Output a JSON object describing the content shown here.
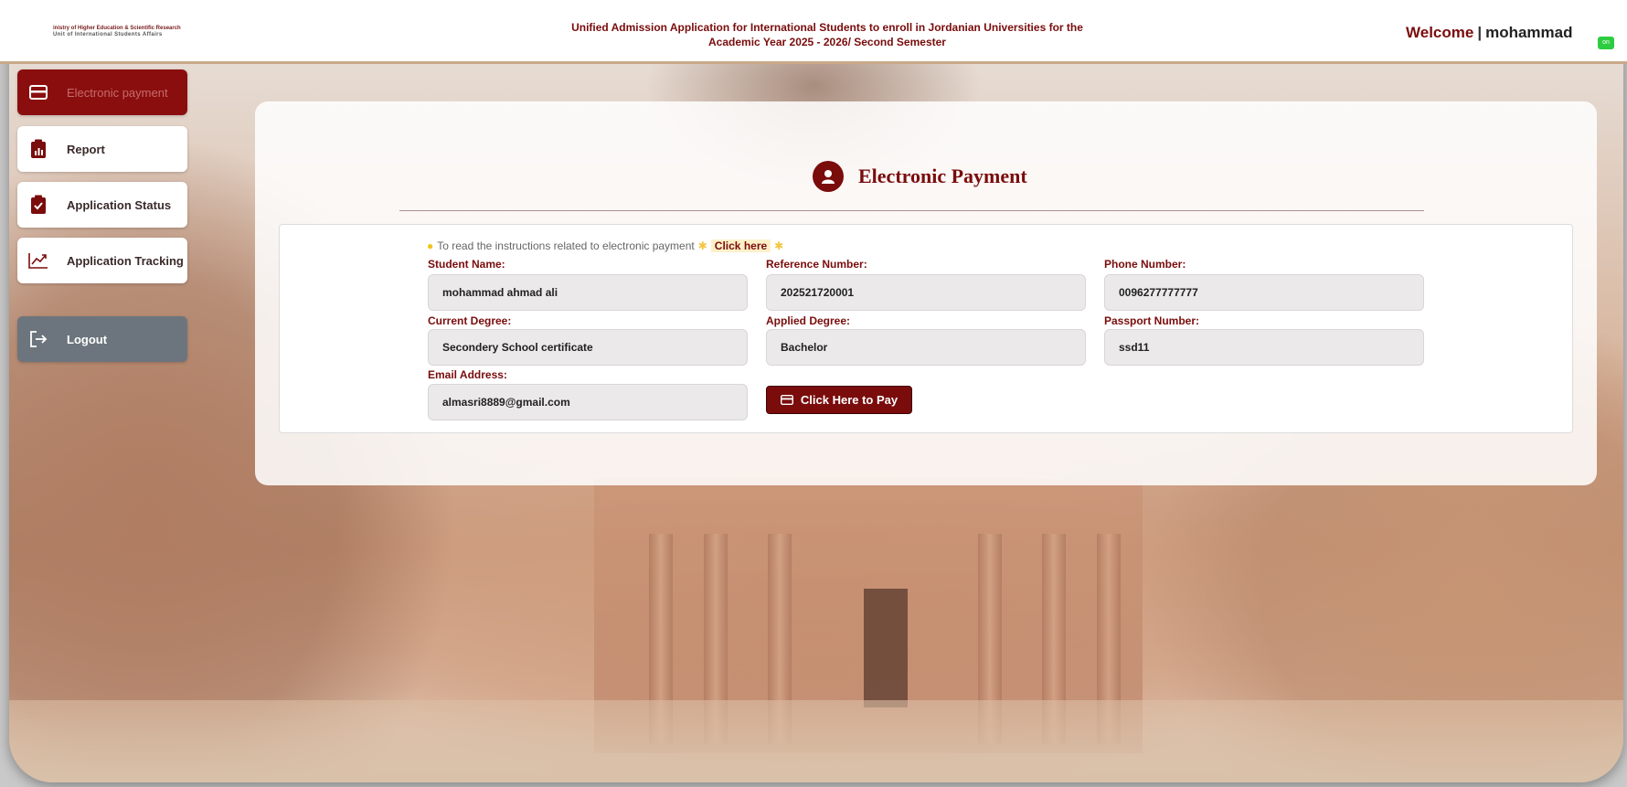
{
  "header": {
    "logo_line1": "inistry of Higher Education & Scientific Research",
    "logo_line2": "Unit of International Students Affairs",
    "title_line1": "Unified Admission Application for International Students to enroll in Jordanian Universities for the",
    "title_line2": "Academic Year 2025 - 2026/ Second Semester",
    "welcome": "Welcome",
    "separator": "|",
    "username": "mohammad",
    "status_badge": "on"
  },
  "sidebar": {
    "items": [
      {
        "label": "Electronic payment",
        "icon": "card-icon",
        "active": true
      },
      {
        "label": "Report",
        "icon": "report-icon"
      },
      {
        "label": "Application Status",
        "icon": "clipboard-check-icon"
      },
      {
        "label": "Application Tracking",
        "icon": "chart-line-icon"
      }
    ],
    "logout_label": "Logout"
  },
  "main": {
    "title": "Electronic Payment",
    "info_text": "To read the instructions related to electronic payment",
    "info_link": "Click here",
    "fields": {
      "student_name": {
        "label": "Student Name:",
        "value": "mohammad ahmad ali"
      },
      "reference_number": {
        "label": "Reference Number:",
        "value": "202521720001"
      },
      "phone_number": {
        "label": "Phone Number:",
        "value": "0096277777777"
      },
      "current_degree": {
        "label": "Current Degree:",
        "value": "Secondery School certificate"
      },
      "applied_degree": {
        "label": "Applied Degree:",
        "value": "Bachelor"
      },
      "passport_number": {
        "label": "Passport Number:",
        "value": "ssd11"
      },
      "email": {
        "label": "Email Address:",
        "value": "almasri8889@gmail.com"
      }
    },
    "pay_button": "Click Here to Pay"
  },
  "colors": {
    "brand": "#7a0c0c",
    "field_bg": "#ebe9ea",
    "logout_bg": "#6c757d"
  }
}
